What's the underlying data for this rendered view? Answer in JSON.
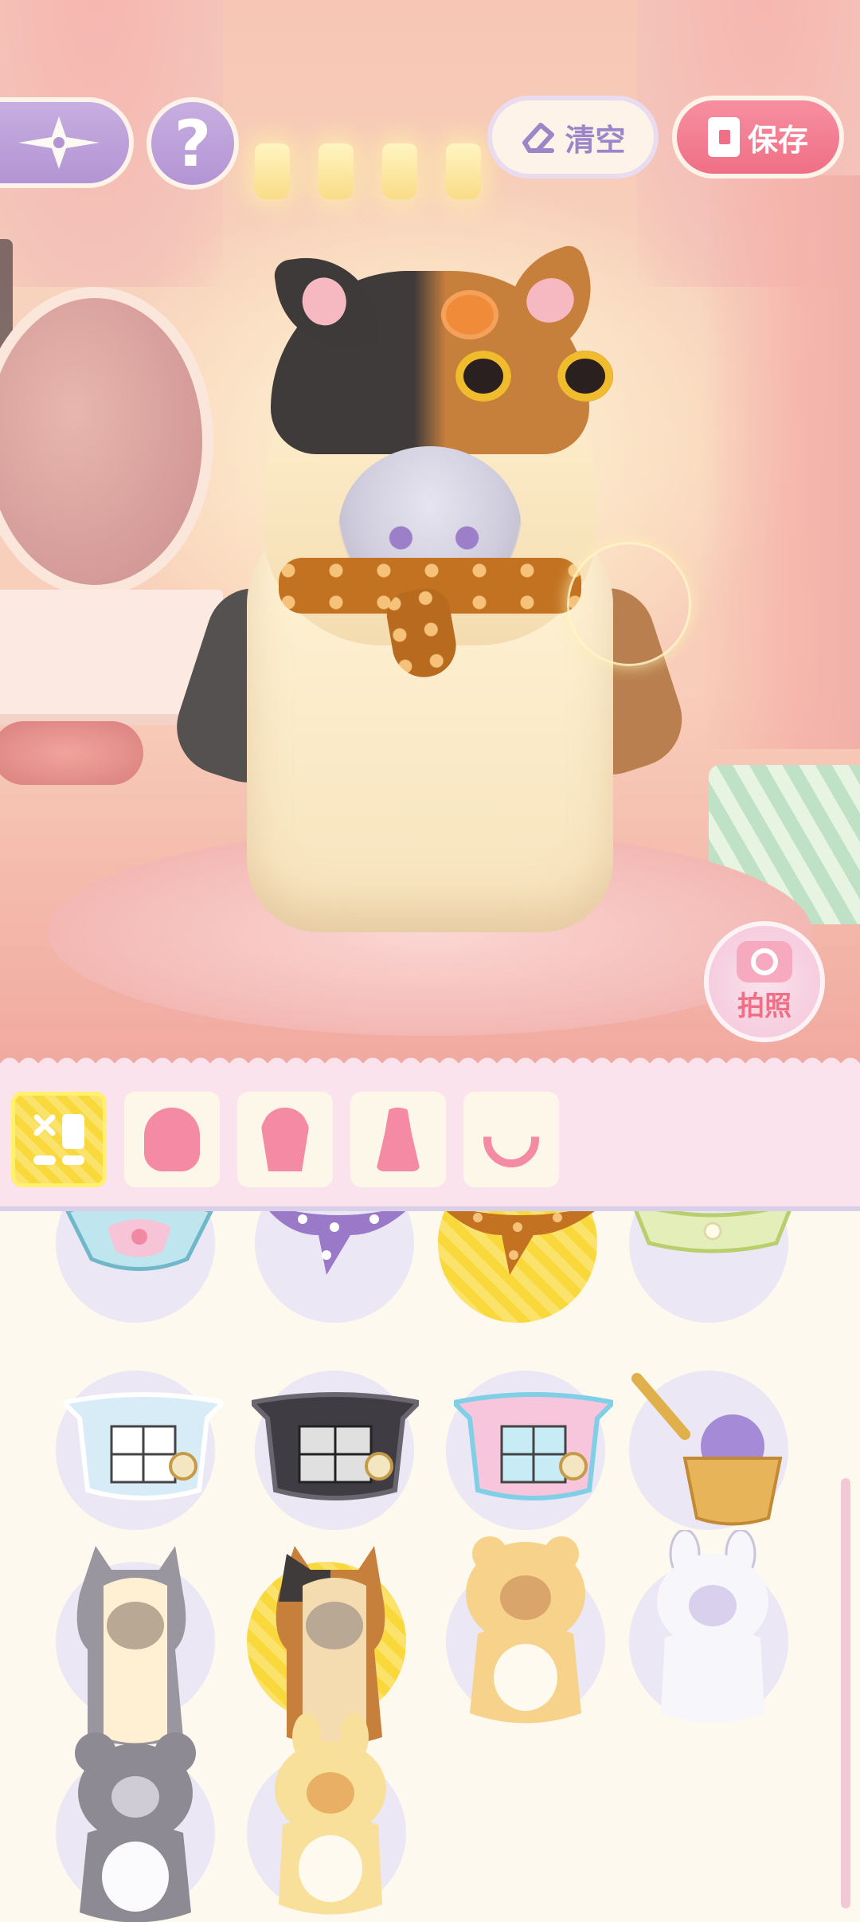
{
  "header": {
    "clear_label": "清空",
    "save_label": "保存",
    "help_label": "?"
  },
  "camera": {
    "label": "拍照"
  },
  "tabs": [
    {
      "icon": "all-items-icon",
      "active": true
    },
    {
      "icon": "hood-outfit-icon",
      "active": false
    },
    {
      "icon": "top-icon",
      "active": false
    },
    {
      "icon": "dress-icon",
      "active": false
    },
    {
      "icon": "necklace-icon",
      "active": false
    }
  ],
  "items": [
    {
      "icon": "teacup-collar-icon"
    },
    {
      "icon": "purple-polka-scarf-icon"
    },
    {
      "icon": "orange-polka-scarf-icon",
      "selected": true
    },
    {
      "icon": "green-plaid-collar-icon"
    },
    {
      "icon": "white-card-apron-icon"
    },
    {
      "icon": "black-card-apron-icon"
    },
    {
      "icon": "pink-card-apron-icon"
    },
    {
      "icon": "flower-basket-icon"
    },
    {
      "icon": "gray-cat-hood-icon"
    },
    {
      "icon": "calico-cat-hood-icon",
      "selected": true
    },
    {
      "icon": "bear-suit-icon"
    },
    {
      "icon": "bunny-suit-icon"
    },
    {
      "icon": "koala-suit-icon"
    },
    {
      "icon": "yellow-bunny-suit-icon"
    }
  ],
  "colors": {
    "accent_pink": "#ef6f86",
    "accent_purple": "#b394d4",
    "selected_yellow": "#f8d83a"
  }
}
